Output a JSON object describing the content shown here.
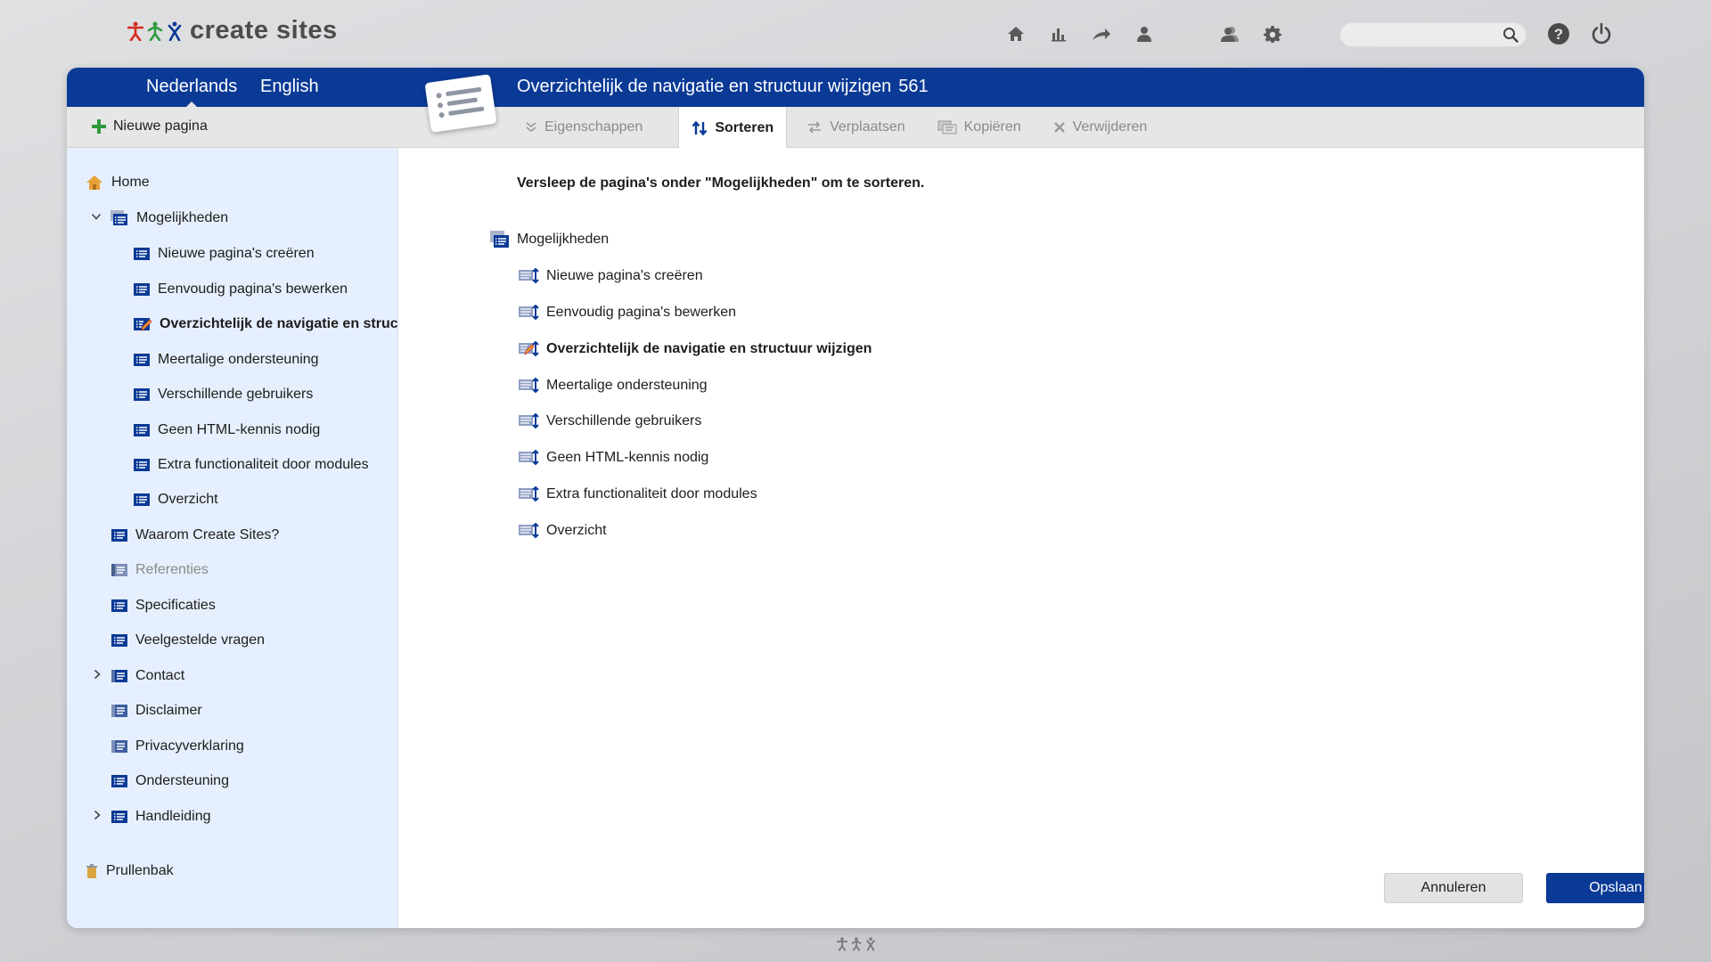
{
  "brand": {
    "name": "create sites"
  },
  "topbar": {
    "icons": [
      "home-icon",
      "stats-icon",
      "share-icon",
      "user-icon",
      "users-icon",
      "gear-icon"
    ],
    "search": {
      "value": "",
      "placeholder": ""
    }
  },
  "header": {
    "languages": [
      {
        "label": "Nederlands",
        "active": true
      },
      {
        "label": "English",
        "active": false
      }
    ],
    "title": "Overzichtelijk de navigatie en structuur wijzigen",
    "page_id": "561",
    "color": "#0a3a96"
  },
  "toolbar": {
    "new_page": "Nieuwe pagina",
    "tabs": [
      {
        "label": "Eigenschappen",
        "icon": "chevron-double-icon",
        "active": false
      },
      {
        "label": "Sorteren",
        "icon": "sort-icon",
        "active": true
      },
      {
        "label": "Verplaatsen",
        "icon": "move-icon",
        "active": false
      },
      {
        "label": "Kopiëren",
        "icon": "copy-icon",
        "active": false
      },
      {
        "label": "Verwijderen",
        "icon": "delete-icon",
        "active": false
      }
    ]
  },
  "sidebar": {
    "home": "Home",
    "items": [
      {
        "label": "Mogelijkheden",
        "level": 1,
        "expanded": true
      },
      {
        "label": "Nieuwe pagina's creëren",
        "level": 2
      },
      {
        "label": "Eenvoudig pagina's bewerken",
        "level": 2
      },
      {
        "label": "Overzichtelijk de navigatie en structuur wijzigen",
        "level": 2,
        "current": true
      },
      {
        "label": "Meertalige ondersteuning",
        "level": 2
      },
      {
        "label": "Verschillende gebruikers",
        "level": 2
      },
      {
        "label": "Geen HTML-kennis nodig",
        "level": 2
      },
      {
        "label": "Extra functionaliteit door modules",
        "level": 2
      },
      {
        "label": "Overzicht",
        "level": 2
      },
      {
        "label": "Waarom Create Sites?",
        "level": 1
      },
      {
        "label": "Referenties",
        "level": 1,
        "muted": true
      },
      {
        "label": "Specificaties",
        "level": 1
      },
      {
        "label": "Veelgestelde vragen",
        "level": 1
      },
      {
        "label": "Contact",
        "level": 1,
        "collapsed": true
      },
      {
        "label": "Disclaimer",
        "level": 1
      },
      {
        "label": "Privacyverklaring",
        "level": 1
      },
      {
        "label": "Ondersteuning",
        "level": 1
      },
      {
        "label": "Handleiding",
        "level": 1,
        "collapsed": true
      }
    ],
    "trash": "Prullenbak"
  },
  "content": {
    "instruction": "Versleep de pagina's onder \"Mogelijkheden\" om te sorteren.",
    "root": "Mogelijkheden",
    "items": [
      {
        "label": "Nieuwe pagina's creëren"
      },
      {
        "label": "Eenvoudig pagina's bewerken"
      },
      {
        "label": "Overzichtelijk de navigatie en structuur wijzigen",
        "current": true
      },
      {
        "label": "Meertalige ondersteuning"
      },
      {
        "label": "Verschillende gebruikers"
      },
      {
        "label": "Geen HTML-kennis nodig"
      },
      {
        "label": "Extra functionaliteit door modules"
      },
      {
        "label": "Overzicht"
      }
    ],
    "cancel": "Annuleren",
    "save": "Opslaan"
  }
}
